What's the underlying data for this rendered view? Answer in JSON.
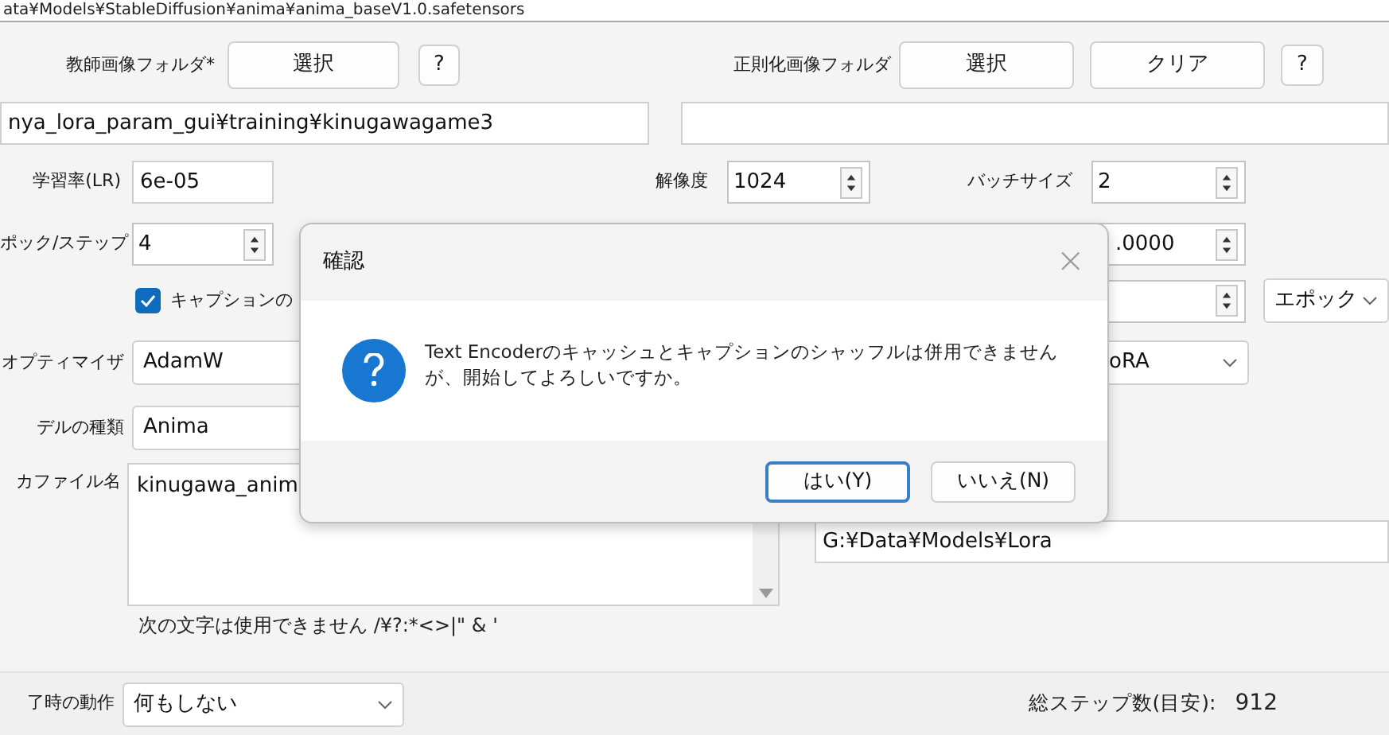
{
  "model_path": {
    "value": "ata¥Models¥StableDiffusion¥anima¥anima_baseV1.0.safetensors"
  },
  "train_folder": {
    "label": "教師画像フォルダ*",
    "select_button": "選択",
    "help_button": "?",
    "path": "nya_lora_param_gui¥training¥kinugawagame3"
  },
  "reg_folder": {
    "label": "正則化画像フォルダ",
    "select_button": "選択",
    "clear_button": "クリア",
    "help_button": "?"
  },
  "learning_rate": {
    "label": "学習率(LR)",
    "value": "6e-05"
  },
  "resolution": {
    "label": "解像度",
    "value": "1024"
  },
  "batch_size": {
    "label": "バッチサイズ",
    "value": "2"
  },
  "epoch_step": {
    "label": "ポック/ステップ",
    "value": "4"
  },
  "spin_right": {
    "value": ".0000"
  },
  "caption_checkbox": {
    "label": "キャプションの",
    "checked": true
  },
  "save_unit": {
    "value": "エポック"
  },
  "optimizer": {
    "label": "オプティマイザ",
    "value": "AdamW"
  },
  "network_type": {
    "value": "oRA"
  },
  "model_type": {
    "label": "デルの種類",
    "value": "Anima"
  },
  "output_name": {
    "label": "カファイル名",
    "value": "kinugawa_anim",
    "hint": "次の文字は使用できません /¥?:*<>|\" & '"
  },
  "output_folder": {
    "value": "G:¥Data¥Models¥Lora"
  },
  "footer": {
    "on_finish_label": "了時の動作",
    "on_finish_value": "何もしない",
    "total_steps_label": "総ステップ数(目安):",
    "total_steps_value": "912"
  },
  "dialog": {
    "title": "確認",
    "close": "×",
    "message": "Text Encoderのキャッシュとキャプションのシャッフルは併用できませんが、開始してよろしいですか。",
    "buttons": [
      {
        "label": "はい(Y)",
        "default": true
      },
      {
        "label": "いいえ(N)",
        "default": false
      }
    ]
  }
}
